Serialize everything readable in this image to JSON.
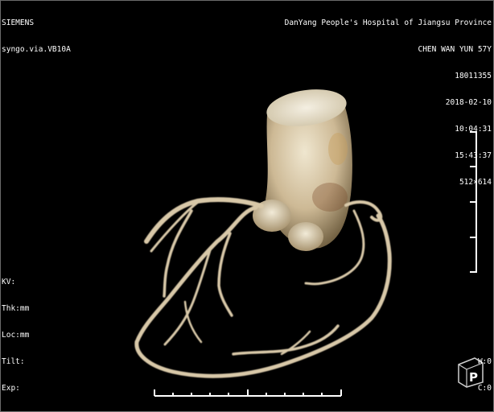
{
  "overlay": {
    "top_left": [
      "SIEMENS",
      "syngo.via.VB10A"
    ],
    "top_right": [
      "DanYang People's Hospital of Jiangsu Province",
      "CHEN WAN YUN 57Y",
      "18011355",
      "2018-02-10",
      "10:04:31",
      "15:43:37",
      "512×614"
    ],
    "bottom_left": [
      "KV:",
      "Thk:mm",
      "Loc:mm",
      "Tilt:",
      "Exp:"
    ],
    "bottom_right": [
      "W:0",
      "C:0"
    ]
  },
  "orientation_marker": {
    "label": "P"
  },
  "icons": {
    "render": "vr-heart-coronary-render",
    "orientation": "orientation-cube-icon"
  },
  "colors": {
    "background": "#000000",
    "overlay_text": "#ffffff",
    "vessel": "#d8c8a8"
  }
}
